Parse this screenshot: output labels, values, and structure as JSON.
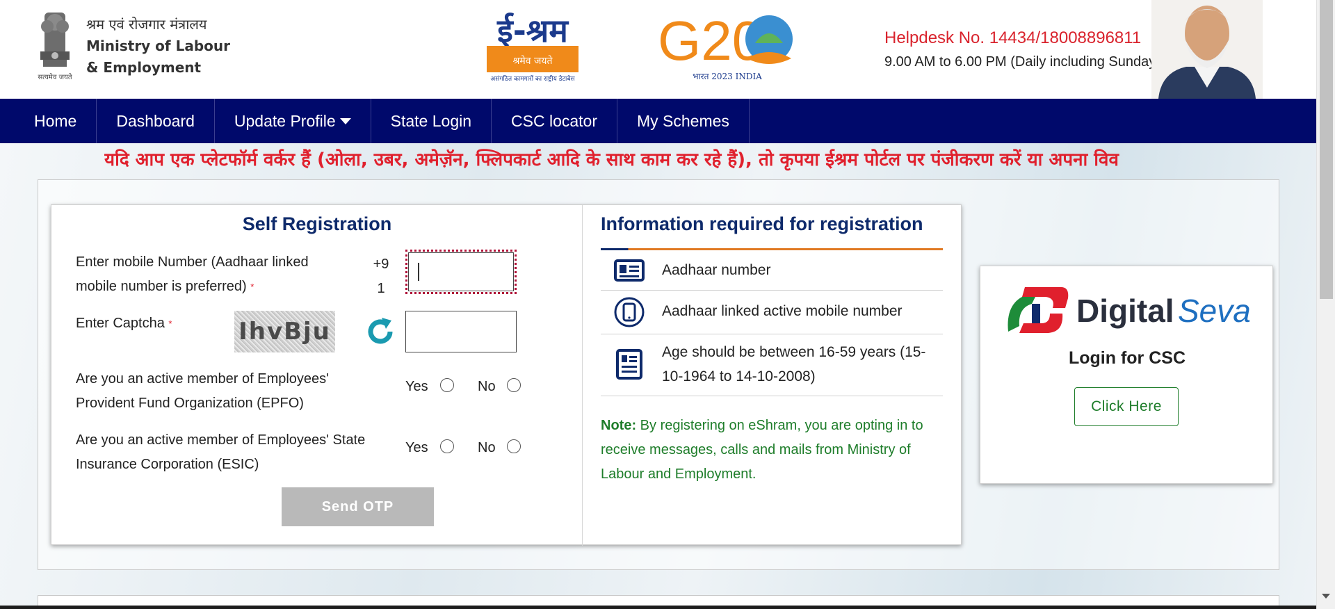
{
  "header": {
    "ministry_hindi": "श्रम एवं रोजगार मंत्रालय",
    "ministry_line1": "Ministry of Labour",
    "ministry_line2": "& Employment",
    "emblem_motto": "सत्यमेव जयते",
    "eshram_title": "ई-श्रम",
    "eshram_tagline": "श्रमेव जयते",
    "eshram_subtitle": "असंगठित कामगारों का राष्ट्रीय डेटाबेस",
    "g20_text": "G20",
    "g20_sub": "भारत 2023 INDIA",
    "helpdesk_line1": "Helpdesk No. 14434/18008896811",
    "helpdesk_line2": "9.00 AM to 6.00 PM (Daily including Sunday)"
  },
  "nav": {
    "items": [
      "Home",
      "Dashboard",
      "Update Profile",
      "State Login",
      "CSC locator",
      "My Schemes"
    ]
  },
  "marquee": "यदि आप एक प्लेटफॉर्म वर्कर हैं (ओला, उबर, अमेज़ॅन, फ्लिपकार्ट आदि के साथ काम कर रहे हैं), तो कृपया ईश्रम पोर्टल पर पंजीकरण करें या अपना विव",
  "self_registration": {
    "title": "Self Registration",
    "mobile_label_line1": "Enter mobile Number (Aadhaar linked",
    "mobile_label_line2": "mobile number is preferred)",
    "country_code_line1": "+9",
    "country_code_line2": "1",
    "mobile_value": "",
    "captcha_label": "Enter Captcha",
    "captcha_text": "IhvBju",
    "captcha_value": "",
    "epfo_line1": "Are you an active member of Employees'",
    "epfo_line2": "Provident Fund Organization (EPFO)",
    "esic_line1": "Are you an active member of Employees' State",
    "esic_line2": "Insurance Corporation (ESIC)",
    "yes": "Yes",
    "no": "No",
    "required_mark": "*",
    "send_otp": "Send OTP"
  },
  "info": {
    "title": "Information required for registration",
    "items": [
      "Aadhaar number",
      "Aadhaar linked active mobile number",
      "Age should be between 16-59 years (15-",
      "10-1964 to 14-10-2008)"
    ],
    "note_label": "Note:",
    "note_line1": " By registering on eShram, you are opting in to",
    "note_line2": "receive messages, calls and mails from Ministry of",
    "note_line3": "Labour and Employment."
  },
  "csc": {
    "logo_digital": "Digital",
    "logo_seva": "Seva",
    "title": "Login for CSC",
    "button": "Click Here"
  },
  "colors": {
    "nav_bg": "#00096b",
    "helpdesk_red": "#d9232d",
    "title_navy": "#0e2a6b",
    "note_green": "#1e7d2a",
    "accent_orange": "#e07a24"
  }
}
